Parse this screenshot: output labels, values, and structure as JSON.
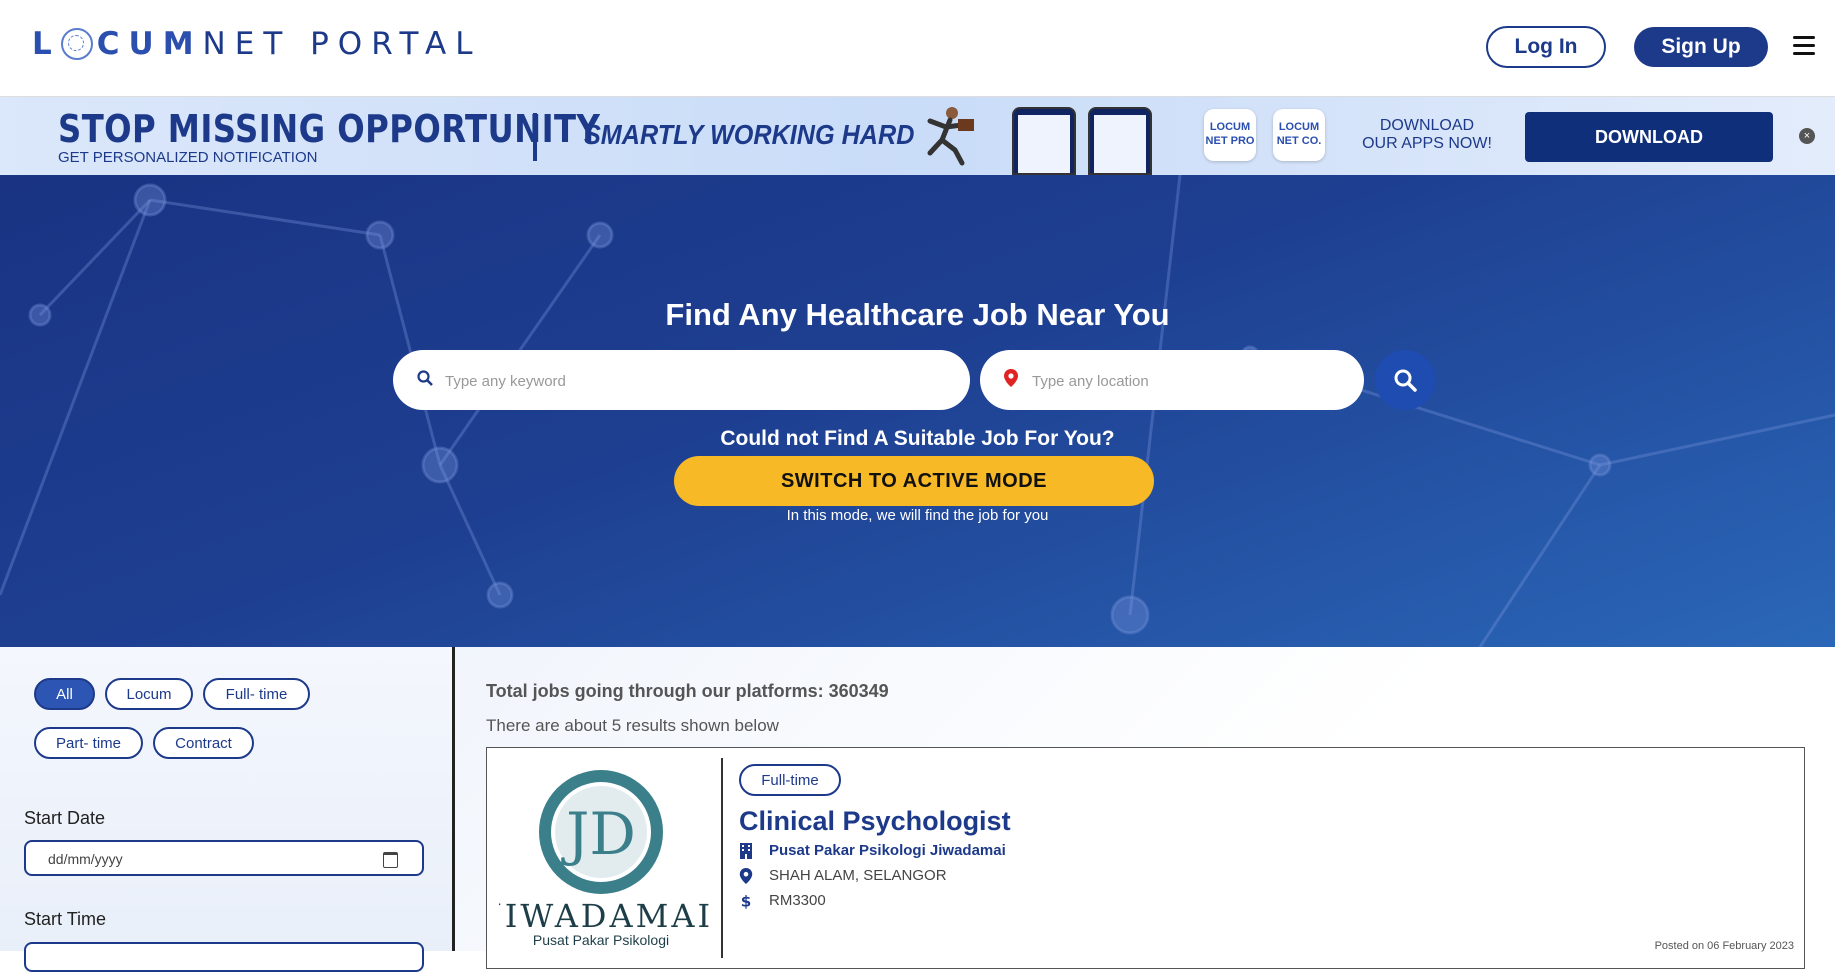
{
  "header": {
    "logo_text": "LOCUMNET PORTAL",
    "login_label": "Log In",
    "signup_label": "Sign Up"
  },
  "banner": {
    "headline": "STOP MISSING OPPORTUNITY",
    "subline": "GET PERSONALIZED NOTIFICATION",
    "tagline": "SMARTLY WORKING HARD",
    "app1": "LOCUM NET PRO",
    "app2": "LOCUM NET CO.",
    "download_text_1": "DOWNLOAD",
    "download_text_2": "OUR APPS NOW!",
    "download_button": "DOWNLOAD",
    "close_glyph": "×"
  },
  "hero": {
    "title": "Find Any Healthcare Job Near You",
    "keyword_placeholder": "Type any keyword",
    "location_placeholder": "Type any location",
    "question": "Could not Find A Suitable Job For You?",
    "active_mode_button": "SWITCH TO ACTIVE MODE",
    "note": "In this mode, we will find the job for you"
  },
  "filters": {
    "chips": [
      {
        "label": "All",
        "active": true
      },
      {
        "label": "Locum",
        "active": false
      },
      {
        "label": "Full- time",
        "active": false
      },
      {
        "label": "Part- time",
        "active": false
      },
      {
        "label": "Contract",
        "active": false
      }
    ],
    "start_date_label": "Start Date",
    "start_date_placeholder": "dd/mm/yyyy",
    "start_time_label": "Start Time"
  },
  "results": {
    "total_text": "Total jobs going through our platforms: 360349",
    "about_text": "There are about 5 results shown below",
    "jobs": [
      {
        "type": "Full-time",
        "title": "Clinical Psychologist",
        "company": "Pusat Pakar Psikologi Jiwadamai",
        "location": "SHAH ALAM, SELANGOR",
        "salary": "RM3300",
        "logo_name": "JIWADAMAI",
        "logo_sub": "Pusat Pakar Psikologi",
        "posted": "Posted on 06 February 2023"
      }
    ]
  },
  "colors": {
    "brand": "#1d3a8a",
    "accent": "#f7b926",
    "hero_bg": "#1e3f91"
  }
}
